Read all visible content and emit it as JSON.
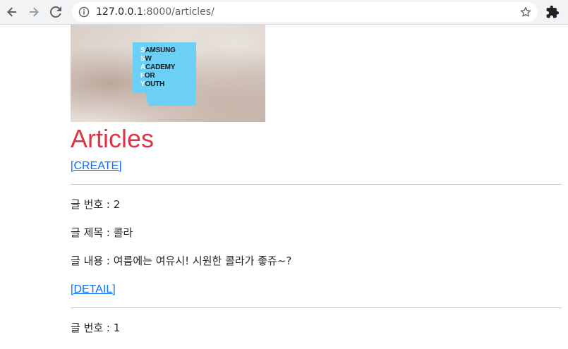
{
  "browser": {
    "url": "127.0.0.1:8000/articles/",
    "url_host": "127.0.0.1",
    "url_rest": ":8000/articles/"
  },
  "banner": {
    "logo_lines": [
      {
        "first": "S",
        "rest": "AMSUNG"
      },
      {
        "first": "S",
        "rest": "W"
      },
      {
        "first": "A",
        "rest": "CADEMY"
      },
      {
        "first": "F",
        "rest": "OR"
      },
      {
        "first": "Y",
        "rest": "OUTH"
      }
    ]
  },
  "page": {
    "title": "Articles",
    "create_link": "[CREATE]"
  },
  "articles": [
    {
      "number_label": "글 번호 : 2",
      "title_label": "글 제목 : 콜라",
      "content_label": "글 내용 : 여름에는 여유시! 시원한 콜라가 좋쥬~?",
      "detail_link": "[DETAIL]"
    },
    {
      "number_label": "글 번호 : 1"
    }
  ],
  "colors": {
    "title": "#dc3545",
    "link": "#0d6efd",
    "logo_bg": "#6ccff6"
  }
}
